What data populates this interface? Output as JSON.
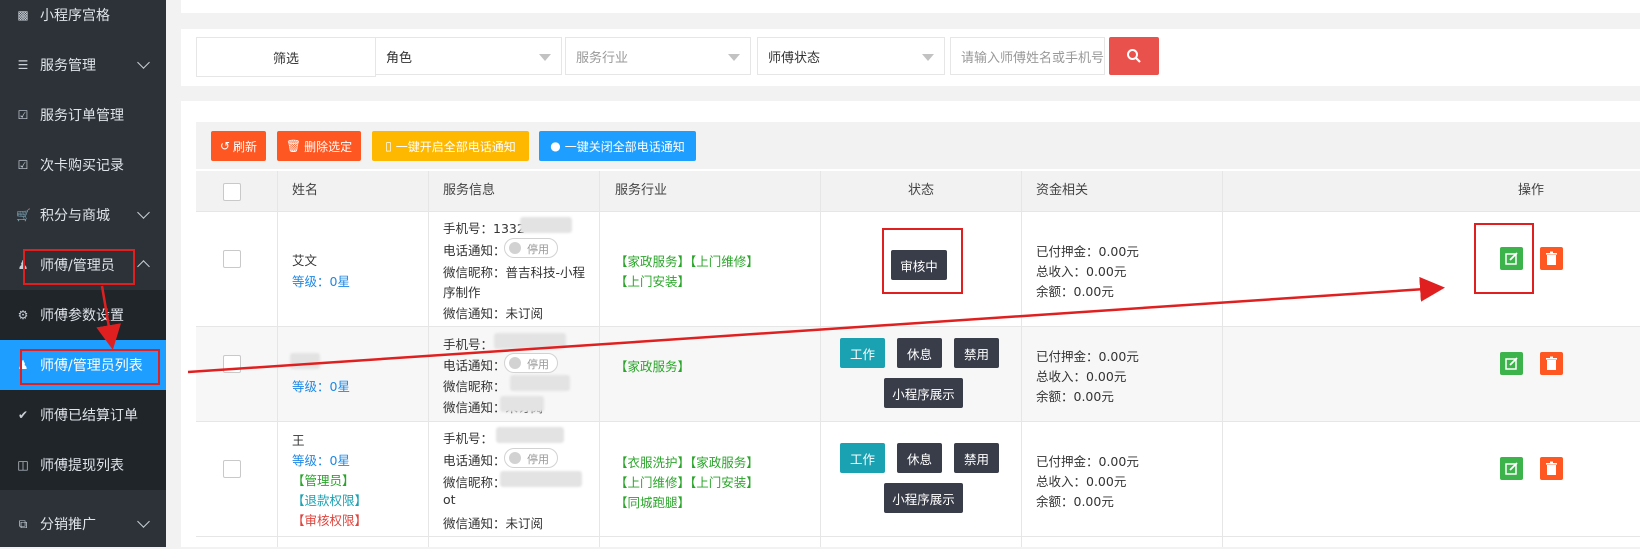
{
  "sidebar": {
    "items": [
      {
        "label": "小程序宫格",
        "icon": "sitemap-icon"
      },
      {
        "label": "服务管理",
        "icon": "server-icon"
      },
      {
        "label": "服务订单管理",
        "icon": "check-square-icon"
      },
      {
        "label": "次卡购买记录",
        "icon": "check-square-icon"
      },
      {
        "label": "积分与商城",
        "icon": "cart-icon"
      },
      {
        "label": "师傅/管理员",
        "icon": "user-tie-icon"
      },
      {
        "label": "师傅参数设置",
        "icon": "gear-icon"
      },
      {
        "label": "师傅/管理员列表",
        "icon": "user-tie-icon"
      },
      {
        "label": "师傅已结算订单",
        "icon": "check-circle-icon"
      },
      {
        "label": "师傅提现列表",
        "icon": "money-icon"
      },
      {
        "label": "分销推广",
        "icon": "share-icon"
      }
    ]
  },
  "filter": {
    "label": "筛选",
    "role_select": "角色",
    "industry_select": "服务行业",
    "status_select": "师傅状态",
    "search_placeholder": "请输入师傅姓名或手机号"
  },
  "toolbar": {
    "refresh": "刷新",
    "delete_selected": "删除选定",
    "enable_all": "一键开启全部电话通知",
    "disable_all": "一键关闭全部电话通知"
  },
  "table": {
    "headers": [
      "姓名",
      "服务信息",
      "服务行业",
      "状态",
      "资金相关",
      "操作"
    ],
    "rows": [
      {
        "name": "艾文",
        "level": "等级：0星",
        "phone": "手机号：1332",
        "call_notify": "电话通知：",
        "toggle": "停用",
        "wechat_nick_1": "微信昵称：普吉科技-小程",
        "wechat_nick_2": "序制作",
        "wechat_notify": "微信通知：未订阅",
        "industry_1": "【家政服务】【上门维修】",
        "industry_2": "【上门安装】",
        "status": "审核中",
        "deposit": "已付押金：0.00元",
        "income": "总收入：0.00元",
        "balance": "余额：0.00元"
      },
      {
        "name": "",
        "level": "等级：0星",
        "phone": "手机号：",
        "call_notify": "电话通知：",
        "toggle": "停用",
        "wechat_nick_1": "微信昵称：",
        "wechat_notify": "微信通知：未订阅",
        "industry_1": "【家政服务】",
        "btn_work": "工作",
        "btn_rest": "休息",
        "btn_ban": "禁用",
        "btn_show": "小程序展示",
        "deposit": "已付押金：0.00元",
        "income": "总收入：0.00元",
        "balance": "余额：0.00元"
      },
      {
        "name": "王",
        "level": "等级：0星",
        "tag_admin": "【管理员】",
        "tag_refund": "【退款权限】",
        "tag_audit": "【审核权限】",
        "phone": "手机号：",
        "call_notify": "电话通知：",
        "toggle": "停用",
        "wechat_nick_1": "微信昵称：",
        "wechat_nick_2": "ot",
        "wechat_notify": "微信通知：未订阅",
        "industry_1": "【衣服洗护】【家政服务】",
        "industry_2": "【上门维修】【上门安装】",
        "industry_3": "【同城跑腿】",
        "btn_work": "工作",
        "btn_rest": "休息",
        "btn_ban": "禁用",
        "btn_show": "小程序展示",
        "deposit": "已付押金：0.00元",
        "income": "总收入：0.00元",
        "balance": "余额：0.00元"
      }
    ]
  },
  "colors": {
    "sidebar_bg": "#2c3238",
    "active": "#1e9fff",
    "search_btn": "#e9514c",
    "refresh_btn": "#ff5722",
    "enable_btn": "#ffb800",
    "disable_btn": "#1e9fff",
    "annotation": "#e02020"
  }
}
